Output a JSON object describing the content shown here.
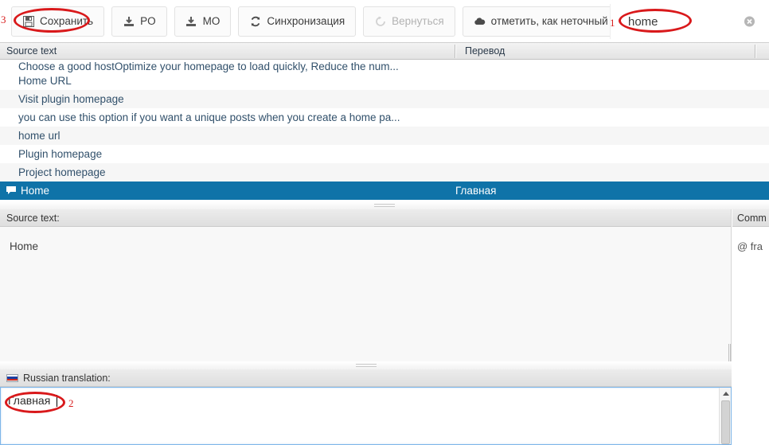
{
  "toolbar": {
    "buttons": [
      {
        "label": "Сохранить",
        "icon": "save-icon",
        "disabled": false
      },
      {
        "label": "PO",
        "icon": "download-icon",
        "disabled": false
      },
      {
        "label": "MO",
        "icon": "download-icon",
        "disabled": false
      },
      {
        "label": "Синхронизация",
        "icon": "sync-icon",
        "disabled": false
      },
      {
        "label": "Вернуться",
        "icon": "revert-icon",
        "disabled": true
      },
      {
        "label": "отметить, как неточный перевод",
        "icon": "cloud-icon",
        "disabled": false
      }
    ],
    "search": {
      "value": "home",
      "placeholder": "",
      "clear_icon": "clear-circle-icon"
    }
  },
  "annotations": [
    {
      "id": "1",
      "target": "search-input"
    },
    {
      "id": "2",
      "target": "translation-textarea"
    },
    {
      "id": "3",
      "target": "save-button"
    }
  ],
  "table": {
    "headers": {
      "source": "Source text",
      "translation": "Перевод"
    },
    "rows": [
      {
        "source": "Choose a good hostOptimize your homepage to load quickly, Reduce the num...",
        "translation": "",
        "selected": false,
        "clipped": true,
        "has_comment": false
      },
      {
        "source": "Home URL",
        "translation": "",
        "selected": false,
        "clipped": false,
        "has_comment": false
      },
      {
        "source": "Visit plugin homepage",
        "translation": "",
        "selected": false,
        "clipped": false,
        "has_comment": false
      },
      {
        "source": "you can use this option if you want a unique posts when you create a home pa...",
        "translation": "",
        "selected": false,
        "clipped": false,
        "has_comment": false
      },
      {
        "source": "home url",
        "translation": "",
        "selected": false,
        "clipped": false,
        "has_comment": false
      },
      {
        "source": "Plugin homepage",
        "translation": "",
        "selected": false,
        "clipped": false,
        "has_comment": false
      },
      {
        "source": "Project homepage",
        "translation": "",
        "selected": false,
        "clipped": false,
        "has_comment": false
      },
      {
        "source": "Home",
        "translation": "Главная",
        "selected": true,
        "clipped": false,
        "has_comment": true
      }
    ]
  },
  "source_panel": {
    "title": "Source text:",
    "text": "Home"
  },
  "comments_panel": {
    "title": "Comm",
    "text": "@ fra"
  },
  "translation_panel": {
    "title": "Russian translation:",
    "flag_icon": "russian-flag-icon",
    "value": "Главная"
  },
  "colors": {
    "selection": "#0f73a8",
    "annotation_red": "#d9191b",
    "link_text": "#31506b",
    "focus_border": "#7eb5e8"
  }
}
